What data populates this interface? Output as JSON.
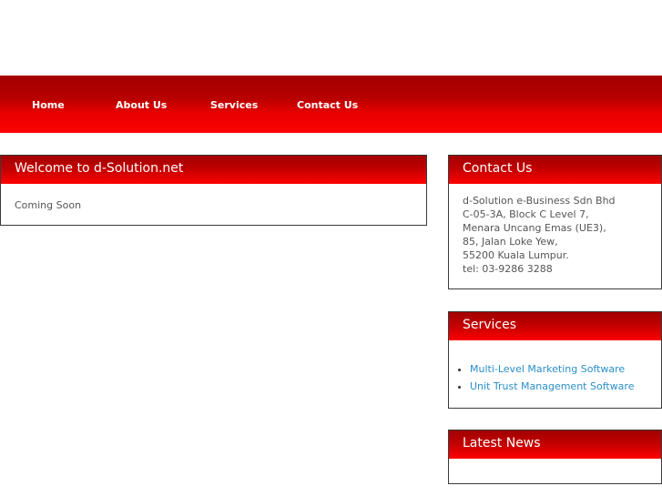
{
  "nav": {
    "items": [
      {
        "label": "Home"
      },
      {
        "label": "About Us"
      },
      {
        "label": "Services"
      },
      {
        "label": "Contact Us"
      }
    ]
  },
  "welcome": {
    "title": "Welcome to d-Solution.net",
    "body": "Coming Soon"
  },
  "contact": {
    "title": "Contact Us",
    "lines": [
      "d-Solution e-Business Sdn Bhd",
      "C-05-3A, Block C Level 7,",
      "Menara Uncang Emas (UE3),",
      "85, Jalan Loke Yew,",
      "55200 Kuala Lumpur.",
      "tel: 03-9286 3288"
    ]
  },
  "services": {
    "title": "Services",
    "links": [
      {
        "label": "Multi-Level Marketing Software"
      },
      {
        "label": "Unit Trust Management Software"
      }
    ]
  },
  "news": {
    "title": "Latest News"
  },
  "colors": {
    "brand_red": "#ff0000",
    "brand_dark_red": "#a30000",
    "link_blue": "#2a8fc9"
  }
}
